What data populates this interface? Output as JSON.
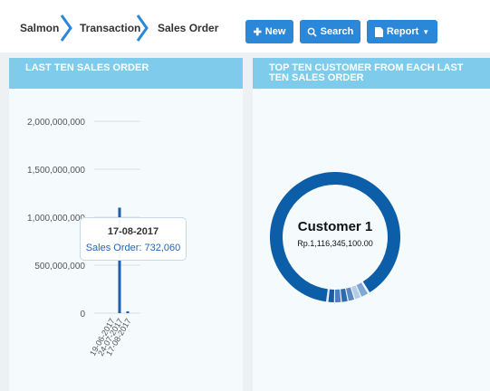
{
  "breadcrumb": [
    "Salmon",
    "Transaction",
    "Sales Order"
  ],
  "toolbar": {
    "new_label": "New",
    "search_label": "Search",
    "report_label": "Report"
  },
  "left_panel": {
    "title": "LAST TEN SALES ORDER",
    "tooltip": {
      "date": "17-08-2017",
      "text": "Sales Order: 732,060"
    }
  },
  "right_panel": {
    "title": "TOP TEN CUSTOMER FROM EACH LAST TEN SALES ORDER",
    "center_name": "Customer 1",
    "center_value": "Rp.1,116,345,100.00"
  },
  "colors": {
    "primary": "#2b87d8",
    "header": "#7ecbeb",
    "bar": "#1f5fa8",
    "donut": "#0d5ea8"
  },
  "chart_data": [
    {
      "type": "bar",
      "categories": [
        "19-06-2017",
        "24-07-2017",
        "17-08-2017"
      ],
      "values": [
        0,
        1100000000,
        732060
      ],
      "ytick_labels": [
        "0",
        "500,000,000",
        "1,000,000,000",
        "1,500,000,000",
        "2,000,000,000"
      ],
      "ylim": [
        0,
        2000000000
      ],
      "grid": true
    },
    {
      "type": "pie",
      "labels": [
        "Customer 1"
      ],
      "values": [
        1116345100
      ],
      "donut": true
    }
  ]
}
